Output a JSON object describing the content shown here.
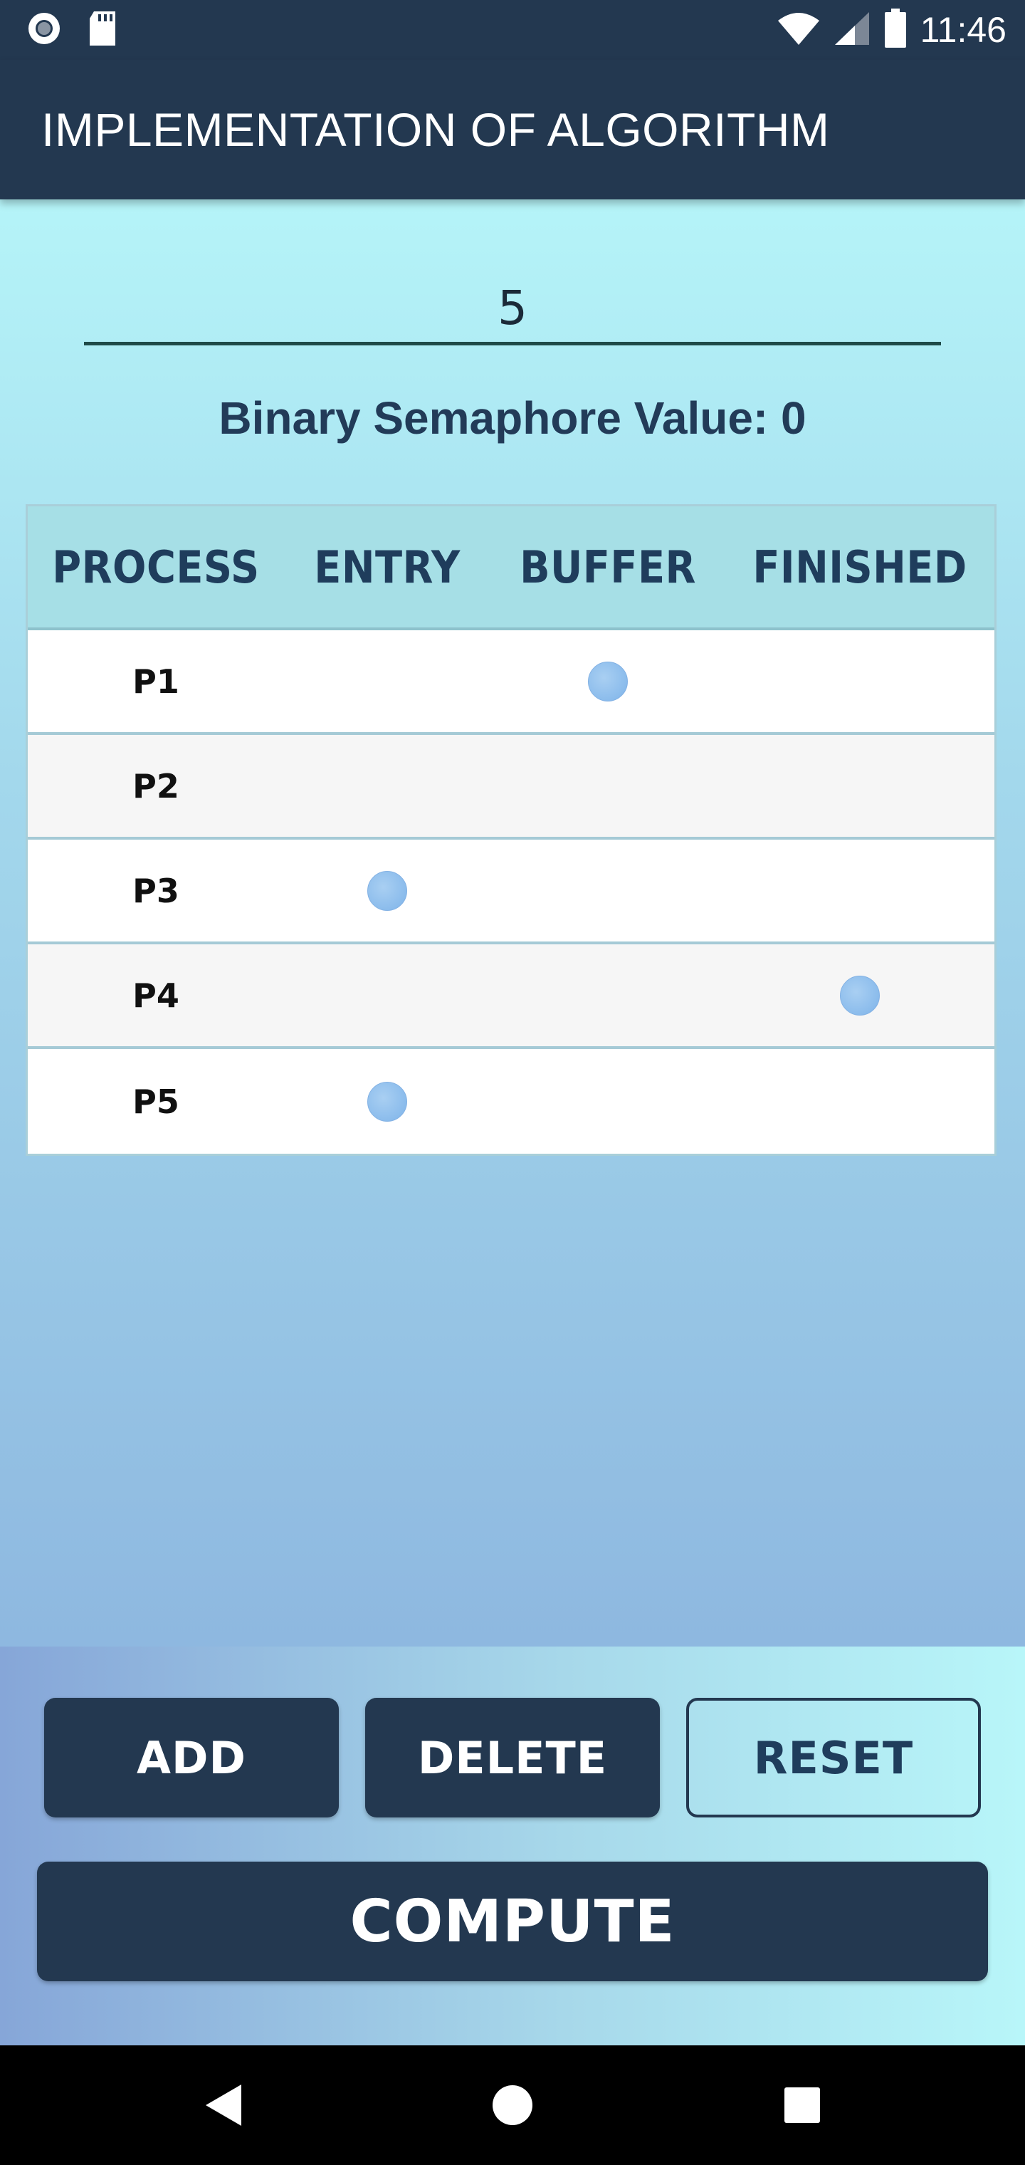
{
  "status_bar": {
    "time": "11:46",
    "icons": [
      "record-icon",
      "sd-card-icon",
      "wifi-icon",
      "signal-icon",
      "battery-icon"
    ]
  },
  "app_bar": {
    "title": "IMPLEMENTATION OF ALGORITHM"
  },
  "input": {
    "value": "5"
  },
  "semaphore_label": "Binary Semaphore Value: 0",
  "table": {
    "headers": [
      "PROCESS",
      "ENTRY",
      "BUFFER",
      "FINISHED"
    ],
    "rows": [
      {
        "name": "P1",
        "state": "BUFFER"
      },
      {
        "name": "P2",
        "state": ""
      },
      {
        "name": "P3",
        "state": "ENTRY"
      },
      {
        "name": "P4",
        "state": "FINISHED"
      },
      {
        "name": "P5",
        "state": "ENTRY"
      }
    ]
  },
  "buttons": {
    "add": "ADD",
    "delete": "DELETE",
    "reset": "RESET",
    "compute": "COMPUTE"
  },
  "nav_bar": {
    "icons": [
      "back-icon",
      "home-icon",
      "recents-icon"
    ]
  },
  "colors": {
    "primary": "#233850",
    "dot": "#8bbcec",
    "header_row": "#a6dfe6"
  }
}
